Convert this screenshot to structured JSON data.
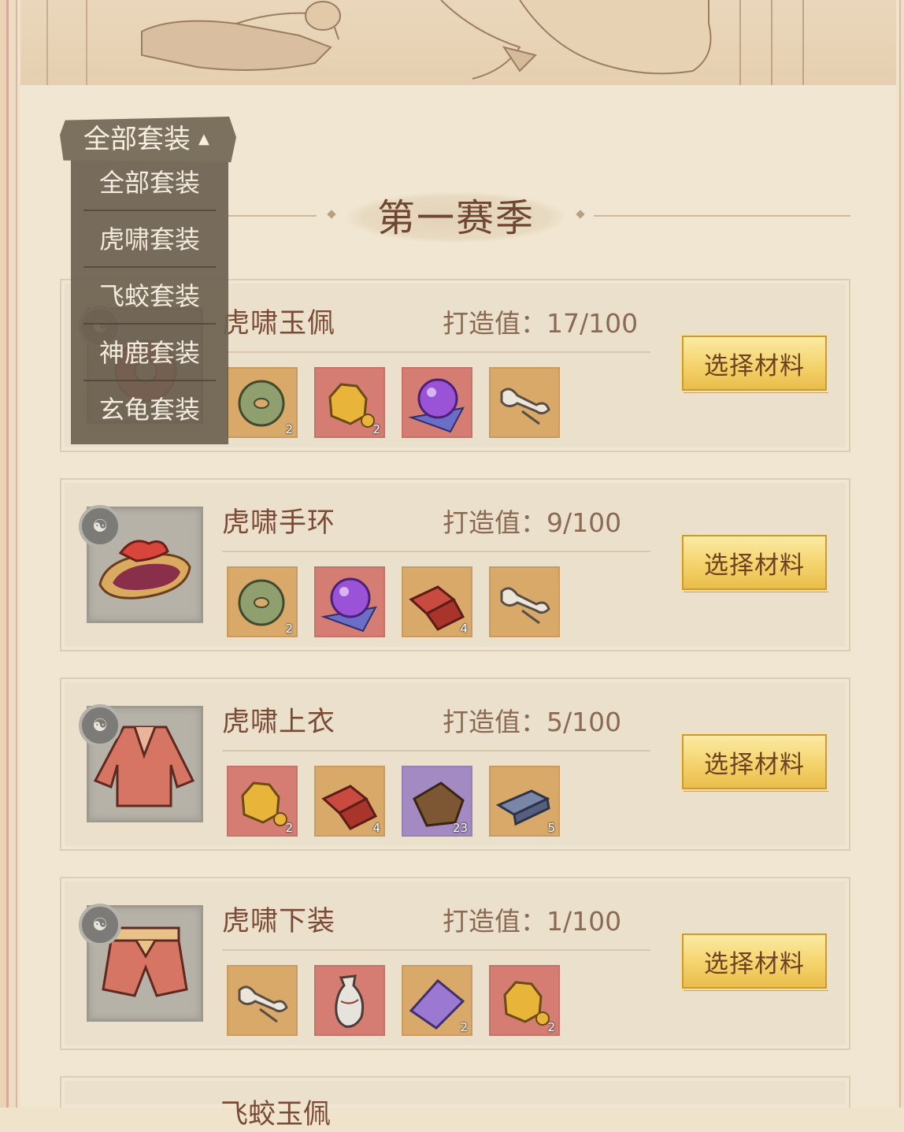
{
  "season": {
    "title": "第一赛季"
  },
  "filter": {
    "selected": "全部套装",
    "options": [
      "全部套装",
      "虎啸套装",
      "飞蛟套装",
      "神鹿套装",
      "玄龟套装"
    ]
  },
  "items": [
    {
      "name": "虎啸玉佩",
      "forge": "打造值：17/100",
      "button": "选择材料",
      "materials": [
        {
          "icon": "jade-disc-icon",
          "bg": "gold",
          "count": "2"
        },
        {
          "icon": "gold-ore-icon",
          "bg": "red",
          "count": "2"
        },
        {
          "icon": "crystal-orb-icon",
          "bg": "red",
          "count": ""
        },
        {
          "icon": "bone-icon",
          "bg": "gold",
          "count": ""
        }
      ]
    },
    {
      "name": "虎啸手环",
      "forge": "打造值：9/100",
      "button": "选择材料",
      "materials": [
        {
          "icon": "jade-disc-icon",
          "bg": "gold",
          "count": "2"
        },
        {
          "icon": "crystal-orb-icon",
          "bg": "red",
          "count": ""
        },
        {
          "icon": "red-brick-icon",
          "bg": "gold",
          "count": "4"
        },
        {
          "icon": "bone-icon",
          "bg": "gold",
          "count": ""
        }
      ]
    },
    {
      "name": "虎啸上衣",
      "forge": "打造值：5/100",
      "button": "选择材料",
      "materials": [
        {
          "icon": "gold-ore-icon",
          "bg": "red",
          "count": "2"
        },
        {
          "icon": "red-brick-icon",
          "bg": "gold",
          "count": "4"
        },
        {
          "icon": "brown-leather-icon",
          "bg": "purple",
          "count": "23"
        },
        {
          "icon": "iron-ingot-icon",
          "bg": "gold",
          "count": "5"
        }
      ]
    },
    {
      "name": "虎啸下装",
      "forge": "打造值：1/100",
      "button": "选择材料",
      "materials": [
        {
          "icon": "bone-icon",
          "bg": "gold",
          "count": ""
        },
        {
          "icon": "porcelain-vase-icon",
          "bg": "red",
          "count": ""
        },
        {
          "icon": "purple-cloth-icon",
          "bg": "gold",
          "count": "2"
        },
        {
          "icon": "gold-ore-icon",
          "bg": "red",
          "count": "2"
        }
      ]
    }
  ],
  "partial_item": {
    "name": "飞蛟玉佩"
  },
  "colors": {
    "background": "#efe3cc",
    "button_gold": "#f4d36c",
    "text_brown": "#7a4a36",
    "mat_gold": "#d9a96a",
    "mat_red": "#d57c73",
    "mat_purple": "#a38ac2"
  }
}
